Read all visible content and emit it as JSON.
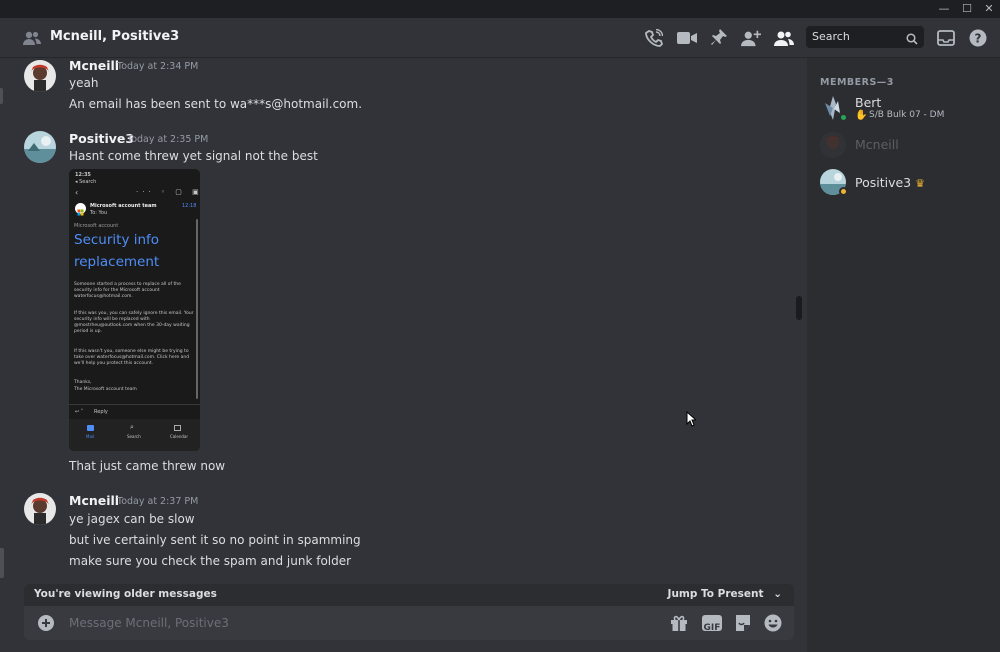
{
  "window": {
    "minimize": "—",
    "maximize": "☐",
    "close": "✕"
  },
  "header": {
    "title": "Mcneill, Positive3",
    "search_placeholder": "Search",
    "icons": [
      "people-icon",
      "voice-call-icon",
      "video-icon",
      "pin-icon",
      "add-friend-icon",
      "members-icon",
      "inbox-icon",
      "help-icon"
    ]
  },
  "messages": [
    {
      "author": "Mcneill",
      "time": "Today at 2:34 PM",
      "lines": [
        "yeah",
        "An email has been sent to wa***s@hotmail.com."
      ]
    },
    {
      "author": "Positive3",
      "time": "Today at 2:35 PM",
      "lines": [
        "Hasnt come threw yet signal not the best"
      ],
      "after_image": "That just came threw now"
    },
    {
      "author": "Mcneill",
      "time": "Today at 2:37 PM",
      "lines": [
        "ye jagex can be slow",
        "but ive certainly sent it so no point in spamming",
        "make sure you check the spam and junk folder"
      ]
    }
  ],
  "attachment": {
    "status_time": "12:35",
    "back_label": "◂ Search",
    "sender": "Microsoft account team",
    "to": "To: You",
    "mail_time": "12:18",
    "brand": "Microsoft account",
    "heading_line1": "Security info",
    "heading_line2": "replacement",
    "para1": "Someone started a process to replace all of the security info for the Microsoft account waterfocus@hotmail.com.",
    "para2": "If this was you, you can safely ignore this email. Your security info will be replaced with @mostrheu@outlook.com when the 30-day waiting period is up.",
    "para3": "If this wasn't you, someone else might be trying to take over waterfocus@hotmail.com. Click here and we'll help you protect this account.",
    "sign1": "Thanks,",
    "sign2": "The Microsoft account team",
    "reply": "Reply",
    "nav": [
      "Mail",
      "Search",
      "Calendar"
    ]
  },
  "composer": {
    "older_notice": "You're viewing older messages",
    "jump_label": "Jump To Present",
    "placeholder": "Message Mcneill, Positive3",
    "gif": "GIF"
  },
  "members": {
    "heading": "MEMBERS—3",
    "list": [
      {
        "name": "Bert",
        "status": "S/B Bulk 07 - DM",
        "presence": "online"
      },
      {
        "name": "Mcneill",
        "presence": "offline"
      },
      {
        "name": "Positive3",
        "presence": "idle",
        "badge": "owner-crown"
      }
    ]
  },
  "colors": {
    "background": "#313338",
    "sidebar": "#2b2d31",
    "online": "#23a55a",
    "idle": "#f0b232",
    "link_blue": "#4e8ef7"
  }
}
